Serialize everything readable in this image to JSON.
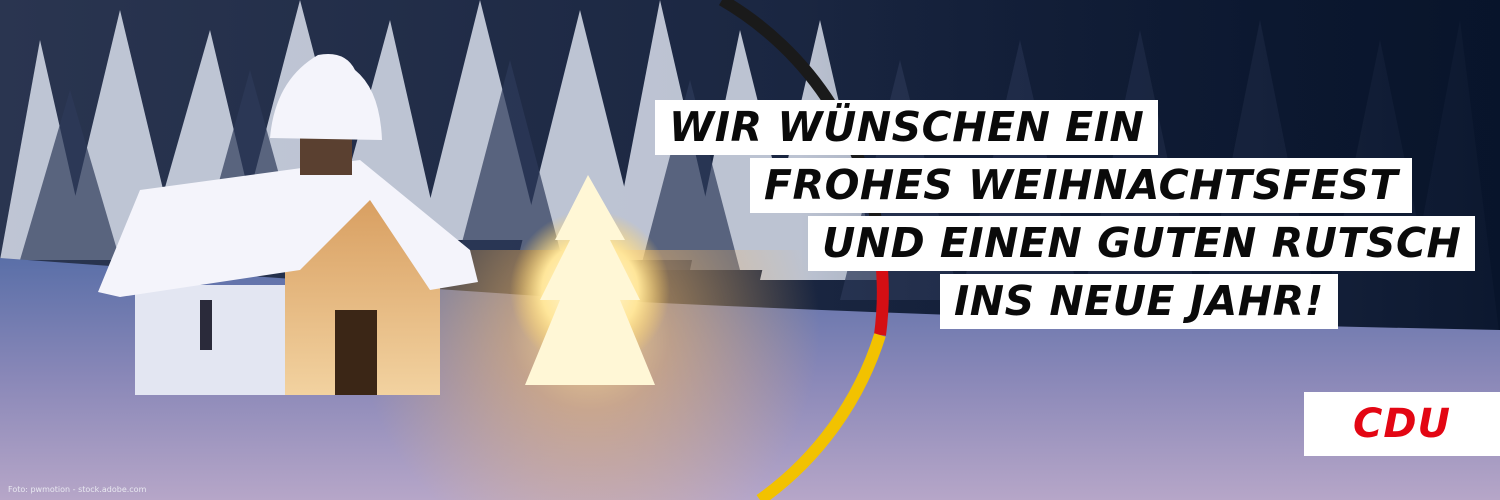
{
  "banner": {
    "headline_lines": [
      "WIR WÜNSCHEN EIN",
      "FROHES WEIHNACHTSFEST",
      "UND EINEN GUTEN RUTSCH",
      "INS NEUE JAHR!"
    ],
    "logo_text": "CDU",
    "photo_credit": "Foto: pwmotion - stock.adobe.com"
  },
  "colors": {
    "brand_red": "#e30613",
    "arc_black": "#1a1a1a",
    "arc_red": "#d40f14",
    "arc_gold": "#f2c200",
    "headline_background": "#ffffff",
    "headline_text": "#0a0a0a"
  }
}
